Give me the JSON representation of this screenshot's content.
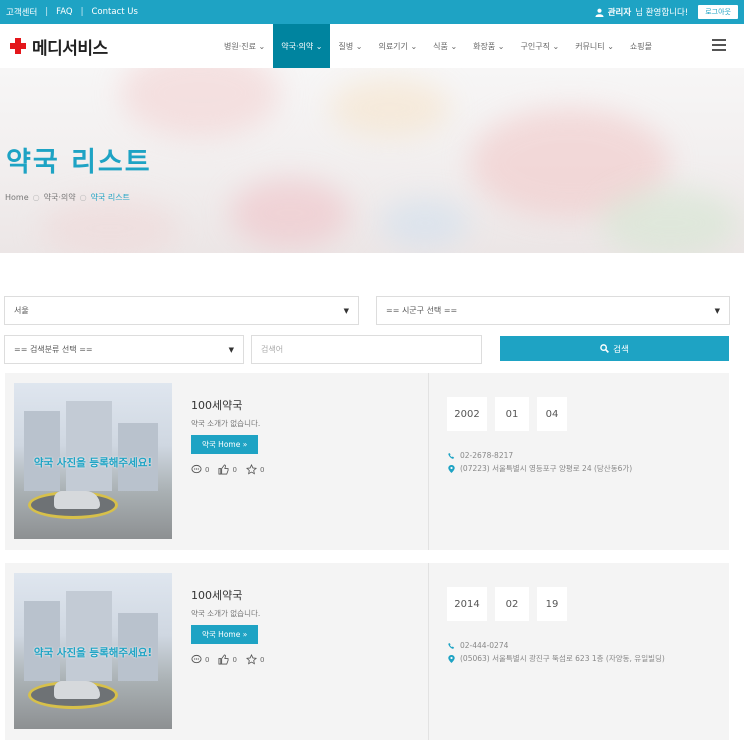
{
  "topbar": {
    "links": [
      "고객센터",
      "FAQ",
      "Contact Us"
    ],
    "separator": "|",
    "greeting_user": "관리자",
    "greeting_suffix": "님 환영합니다!",
    "logout_label": "로그아웃"
  },
  "header": {
    "logo_text": "메디서비스",
    "menu": [
      {
        "label": "병원·진료",
        "active": false
      },
      {
        "label": "약국·의약",
        "active": true
      },
      {
        "label": "질병",
        "active": false
      },
      {
        "label": "의료기기",
        "active": false
      },
      {
        "label": "식품",
        "active": false
      },
      {
        "label": "화장품",
        "active": false
      },
      {
        "label": "구인구직",
        "active": false
      },
      {
        "label": "커뮤니티",
        "active": false
      },
      {
        "label": "쇼핑몰",
        "active": false
      }
    ],
    "dropdown_glyph": "⌄"
  },
  "hero": {
    "title": "약국 리스트",
    "breadcrumb": [
      "Home",
      "약국·의약",
      "약국 리스트"
    ]
  },
  "filters": {
    "region_select": "서울",
    "district_select": "== 시군구 선택 ==",
    "category_select": "== 검색분류 선택 ==",
    "keyword_placeholder": "검색어",
    "search_label": "검색"
  },
  "pharmacies": [
    {
      "name": "100세약국",
      "description": "약국 소개가 없습니다.",
      "home_label": "약국 Home »",
      "photo_caption": "약국 사진을 등록해주세요!",
      "comments": "0",
      "likes": "0",
      "stars": "0",
      "year": "2002",
      "month": "01",
      "day": "04",
      "phone": "02-2678-8217",
      "address": "(07223) 서울특별시 영등포구 양평로 24 (당산동6가)"
    },
    {
      "name": "100세약국",
      "description": "약국 소개가 없습니다.",
      "home_label": "약국 Home »",
      "photo_caption": "약국 사진을 등록해주세요!",
      "comments": "0",
      "likes": "0",
      "stars": "0",
      "year": "2014",
      "month": "02",
      "day": "19",
      "phone": "02-444-0274",
      "address": "(05063) 서울특별시 광진구 뚝섬로 623 1층 (자양동, 유일빌딩)"
    }
  ],
  "colors": {
    "accent": "#1ea3c4",
    "nav_active": "#00849f",
    "logo_red": "#e4161b"
  }
}
